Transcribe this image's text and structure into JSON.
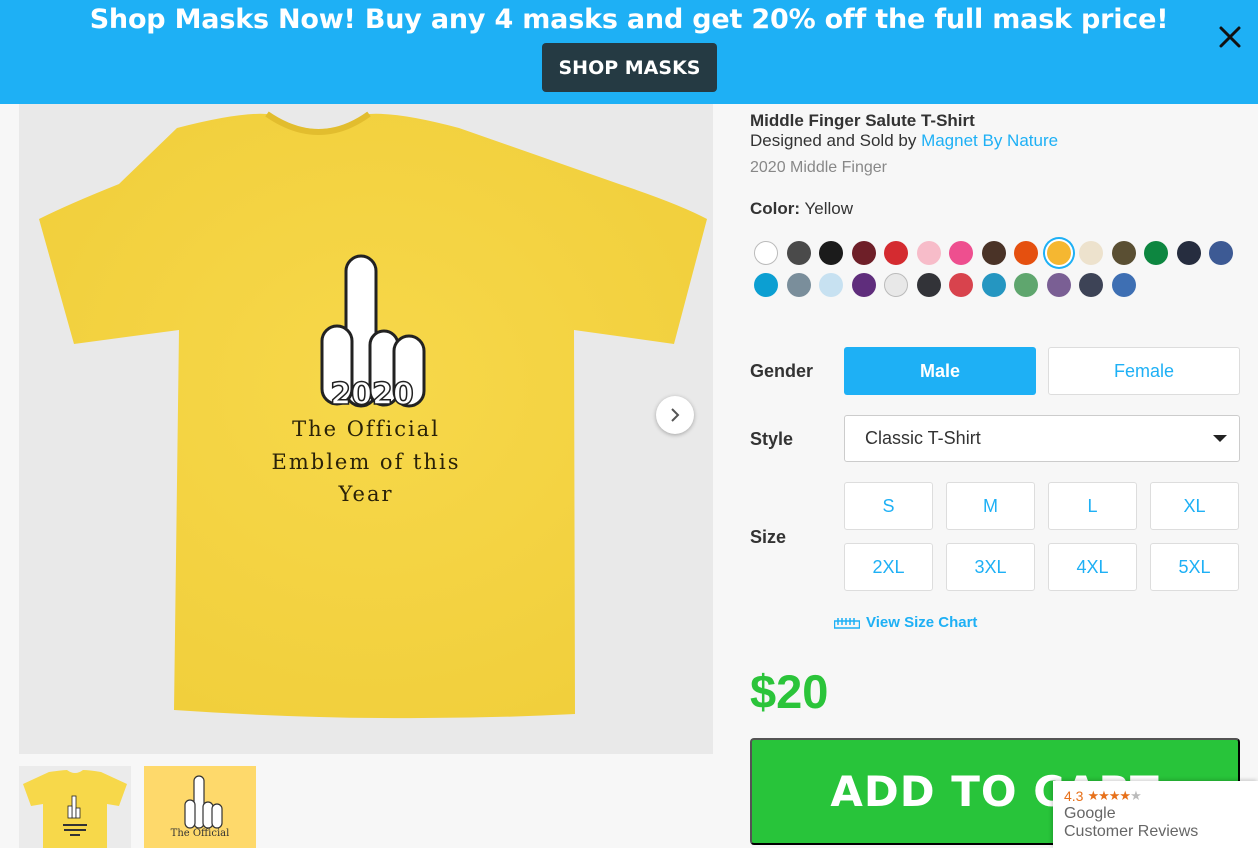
{
  "promo": {
    "text": "Shop Masks Now! Buy any 4 masks and get 20% off the full mask price!",
    "button": "SHOP MASKS"
  },
  "product": {
    "title": "Middle Finger Salute T-Shirt",
    "designed_by_prefix": "Designed and Sold by ",
    "designer": "Magnet By Nature",
    "collection": "2020 Middle Finger",
    "color_label": "Color:",
    "color_value": "Yellow",
    "swatches": [
      "#ffffff",
      "#4a4a4a",
      "#1b1b1b",
      "#6e1f28",
      "#d42b30",
      "#f7bcc9",
      "#ee4f8f",
      "#4a3327",
      "#e5500f",
      "#f5b731",
      "#ede2cd",
      "#5a4f33",
      "#0d8640",
      "#262d3f",
      "#3d5a94",
      "#0c9fd2",
      "#7a8e9b",
      "#c7e1f1",
      "#5f2d7c",
      "#e8e8e8",
      "#323338",
      "#d8434d",
      "#2596c1",
      "#5fa66e",
      "#7a5f94",
      "#3d4356",
      "#3e6fb3"
    ],
    "selected_swatch_index": 9,
    "shirt_text": [
      "The Official",
      "Emblem of this",
      "Year"
    ],
    "shirt_year": "2020"
  },
  "options": {
    "gender_label": "Gender",
    "gender_male": "Male",
    "gender_female": "Female",
    "style_label": "Style",
    "style_value": "Classic T-Shirt",
    "size_label": "Size",
    "sizes": [
      "S",
      "M",
      "L",
      "XL",
      "2XL",
      "3XL",
      "4XL",
      "5XL"
    ],
    "size_chart": "View Size Chart"
  },
  "price": "$20",
  "add_to_cart": "ADD TO CART",
  "reviews": {
    "rating": "4.3",
    "google": "Google",
    "label": "Customer Reviews"
  }
}
